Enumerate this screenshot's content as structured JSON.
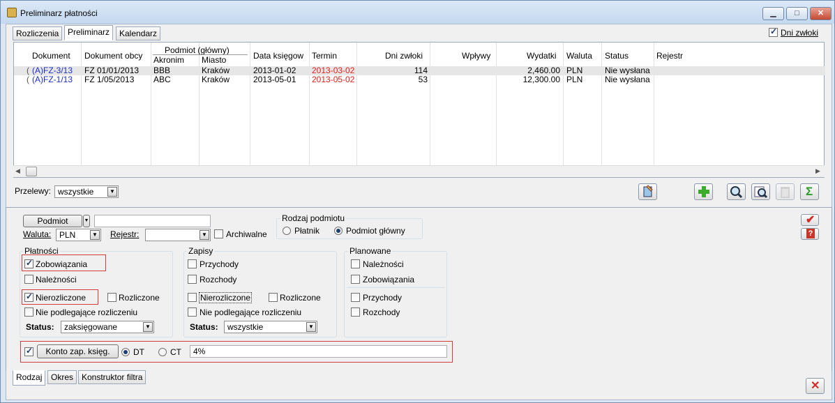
{
  "window": {
    "title": "Preliminarz płatności"
  },
  "tabs_top": [
    "Rozliczenia",
    "Preliminarz",
    "Kalendarz"
  ],
  "dni_zwloki": {
    "label": "Dni zwłoki",
    "checked": true
  },
  "grid": {
    "group_header": "Podmiot (główny)",
    "columns": {
      "dokument": "Dokument",
      "dokument_obcy": "Dokument obcy",
      "akronim": "Akronim",
      "miasto": "Miasto",
      "data": "Data księgow",
      "termin": "Termin",
      "dni": "Dni zwłoki",
      "wplywy": "Wpływy",
      "wydatki": "Wydatki",
      "waluta": "Waluta",
      "status": "Status",
      "rejestr": "Rejestr"
    },
    "rows": [
      {
        "dokument": "(A)FZ-3/13",
        "obcy": "FZ 01/01/2013",
        "akronim": "BBB",
        "miasto": "Kraków",
        "data": "2013-01-02",
        "termin": "2013-03-02",
        "dni": "114",
        "wplywy": "",
        "wydatki": "2,460.00",
        "waluta": "PLN",
        "status": "Nie wysłana"
      },
      {
        "dokument": "(A)FZ-1/13",
        "obcy": "FZ 1/05/2013",
        "akronim": "ABC",
        "miasto": "Kraków",
        "data": "2013-05-01",
        "termin": "2013-05-02",
        "dni": "53",
        "wplywy": "",
        "wydatki": "12,300.00",
        "waluta": "PLN",
        "status": "Nie wysłana"
      }
    ]
  },
  "przelewy": {
    "label": "Przelewy:",
    "value": "wszystkie"
  },
  "filter": {
    "podmiot_button": "Podmiot",
    "waluta_label": "Waluta:",
    "waluta_value": "PLN",
    "rejestr_label": "Rejestr:",
    "archiwalne": "Archiwalne",
    "rodzaj_podmiotu": {
      "title": "Rodzaj podmiotu",
      "platnik": "Płatnik",
      "glowny": "Podmiot główny"
    },
    "platnosci": {
      "title": "Płatności",
      "zobowiazania": "Zobowiązania",
      "naleznosci": "Należności",
      "nierozliczone": "Nierozliczone",
      "rozliczone": "Rozliczone",
      "nie_podlegajace": "Nie podlegające rozliczeniu",
      "status_label": "Status:",
      "status_value": "zaksięgowane"
    },
    "zapisy": {
      "title": "Zapisy",
      "przychody": "Przychody",
      "rozchody": "Rozchody",
      "nierozliczone": "Nierozliczone",
      "rozliczone": "Rozliczone",
      "nie_podlegajace": "Nie podlegające rozliczeniu",
      "status_label": "Status:",
      "status_value": "wszystkie"
    },
    "planowane": {
      "title": "Planowane",
      "naleznosci": "Należności",
      "zobowiazania": "Zobowiązania",
      "przychody": "Przychody",
      "rozchody": "Rozchody"
    },
    "konto": {
      "button": "Konto zap. księg.",
      "dt": "DT",
      "ct": "CT",
      "value": "4%"
    }
  },
  "tabs_bottom": [
    "Rodzaj",
    "Okres",
    "Konstruktor filtra"
  ],
  "colors": {
    "accent_red": "#d23c3c",
    "link_blue": "#1d2fc4",
    "overdue_red": "#e0201c"
  }
}
